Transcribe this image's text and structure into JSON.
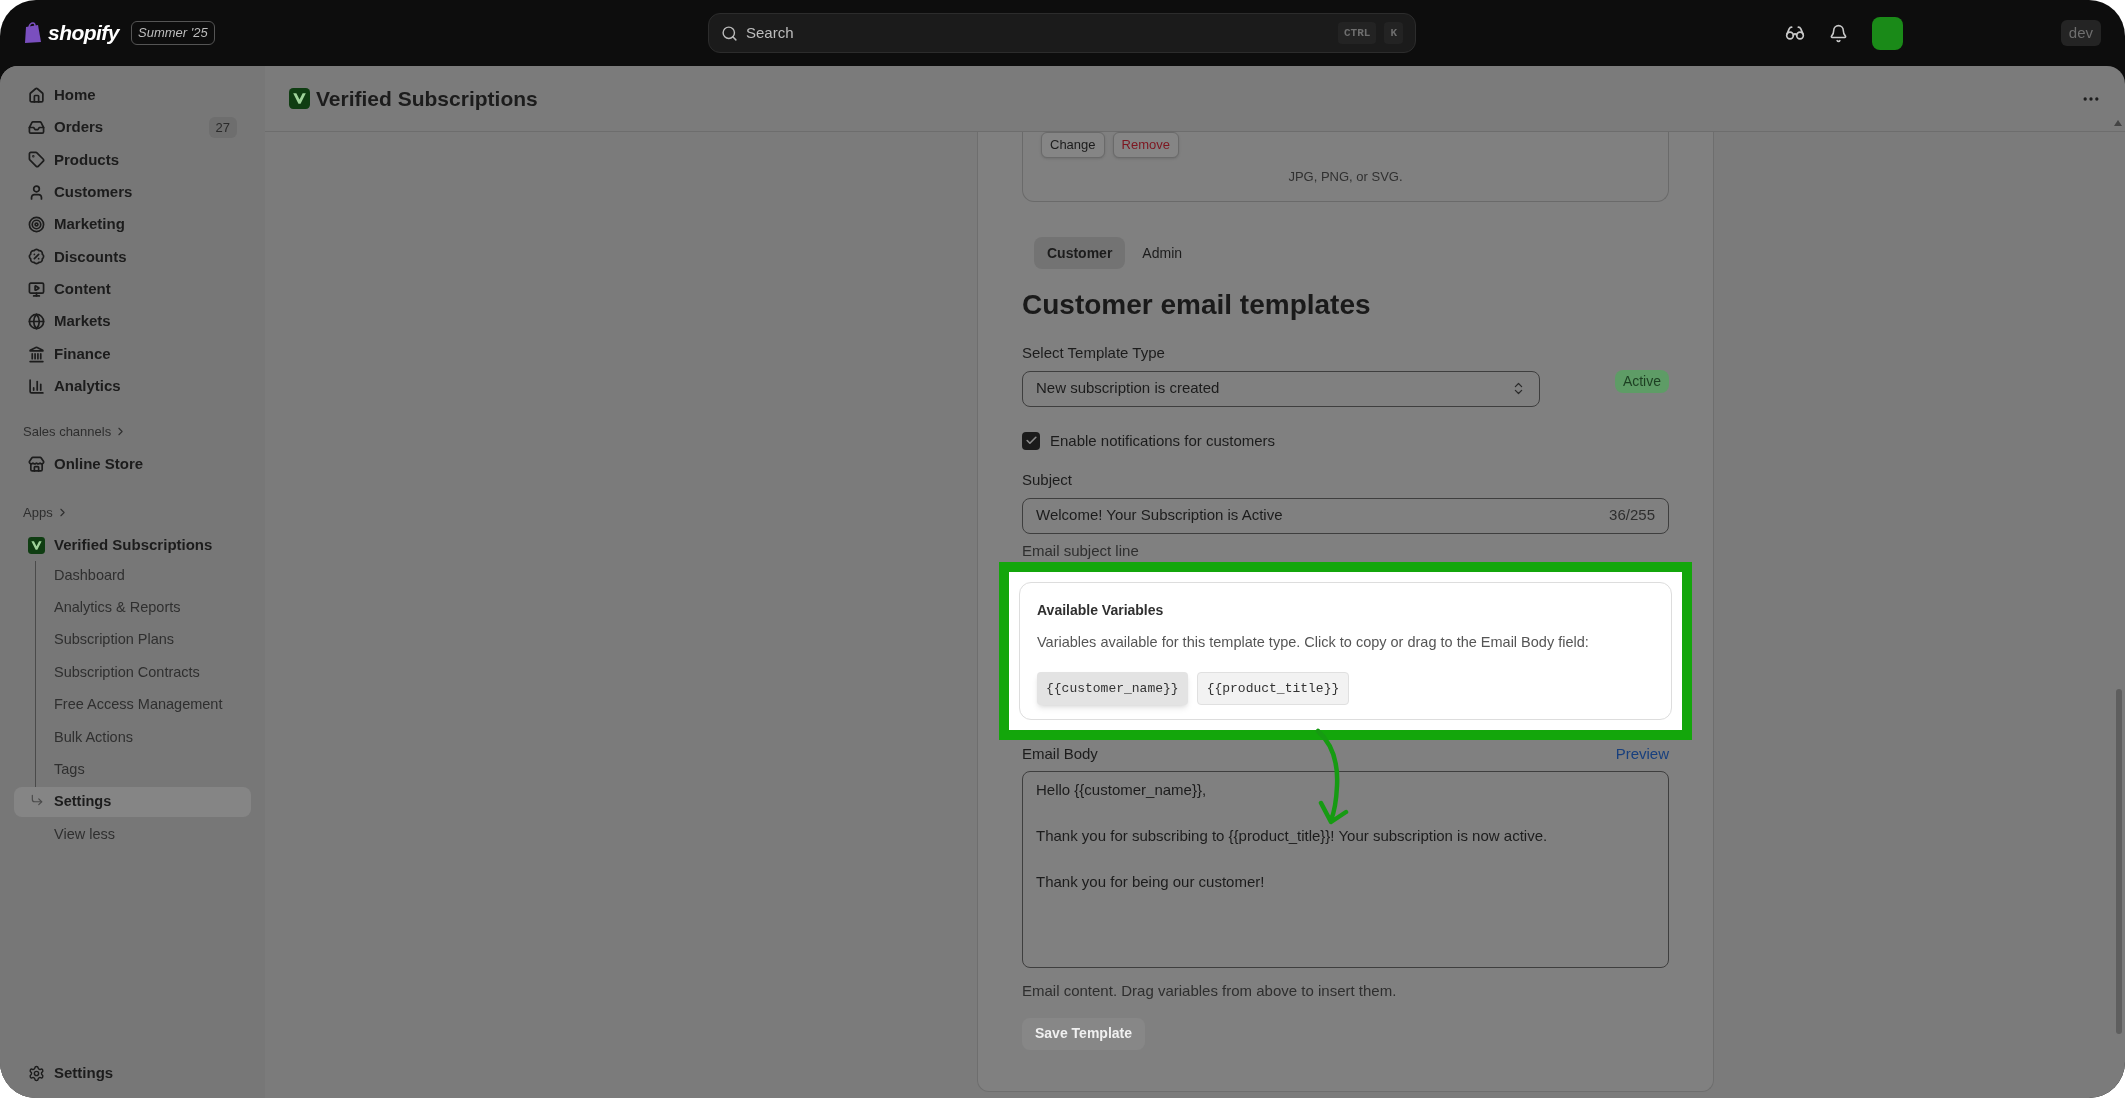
{
  "topbar": {
    "logo": "shopify",
    "edition": "Summer '25",
    "search": {
      "placeholder": "Search",
      "keys": [
        "CTRL",
        "K"
      ]
    },
    "store_badge": "dev"
  },
  "sidebar": {
    "items": [
      {
        "label": "Home",
        "selected": false
      },
      {
        "label": "Orders",
        "count": "27",
        "selected": false
      },
      {
        "label": "Products",
        "selected": false
      },
      {
        "label": "Customers",
        "selected": false
      },
      {
        "label": "Marketing",
        "selected": false
      },
      {
        "label": "Discounts",
        "selected": false
      },
      {
        "label": "Content",
        "selected": false
      },
      {
        "label": "Markets",
        "selected": false
      },
      {
        "label": "Finance",
        "selected": false
      },
      {
        "label": "Analytics",
        "selected": false
      }
    ],
    "sales_channels": {
      "title": "Sales channels",
      "items": [
        {
          "label": "Online Store",
          "selected": false
        }
      ]
    },
    "apps": {
      "title": "Apps",
      "app": {
        "label": "Verified Subscriptions",
        "children": [
          {
            "label": "Dashboard",
            "selected": false
          },
          {
            "label": "Analytics & Reports",
            "selected": false
          },
          {
            "label": "Subscription Plans",
            "selected": false
          },
          {
            "label": "Subscription Contracts",
            "selected": false
          },
          {
            "label": "Free Access Management",
            "selected": false
          },
          {
            "label": "Bulk Actions",
            "selected": false
          },
          {
            "label": "Tags",
            "selected": false
          },
          {
            "label": "Settings",
            "selected": true
          }
        ]
      },
      "toggle": "View less"
    },
    "footer": "Settings"
  },
  "page": {
    "title": "Verified Subscriptions"
  },
  "card": {
    "upload": {
      "buttons": [
        {
          "label": "Change",
          "kind": "default"
        },
        {
          "label": "Remove",
          "kind": "critical"
        }
      ],
      "hint": "JPG, PNG, or SVG."
    },
    "tabs": [
      {
        "label": "Customer",
        "selected": true
      },
      {
        "label": "Admin",
        "selected": false
      }
    ],
    "heading": "Customer email templates",
    "template_select": {
      "label": "Select Template Type",
      "value": "New subscription is created"
    },
    "status": "Active",
    "notifications": {
      "label": "Enable notifications for customers",
      "checked": true
    },
    "subject": {
      "label": "Subject",
      "value": "Welcome! Your Subscription is Active",
      "counter": "36/255",
      "help": "Email subject line"
    },
    "variables": {
      "title": "Available Variables",
      "description": "Variables available for this template type. Click to copy or drag to the Email Body field:",
      "chips": [
        {
          "label": "{{customer_name}}",
          "hovered": true
        },
        {
          "label": "{{product_title}}",
          "hovered": false
        }
      ]
    },
    "body": {
      "label": "Email Body",
      "link": "Preview",
      "value": "Hello {{customer_name}},\n\nThank you for subscribing to {{product_title}}! Your subscription is now active.\n\nThank you for being our customer!",
      "help": "Email content. Drag variables from above to insert them."
    },
    "save": {
      "label": "Save Template",
      "disabled": true
    }
  }
}
